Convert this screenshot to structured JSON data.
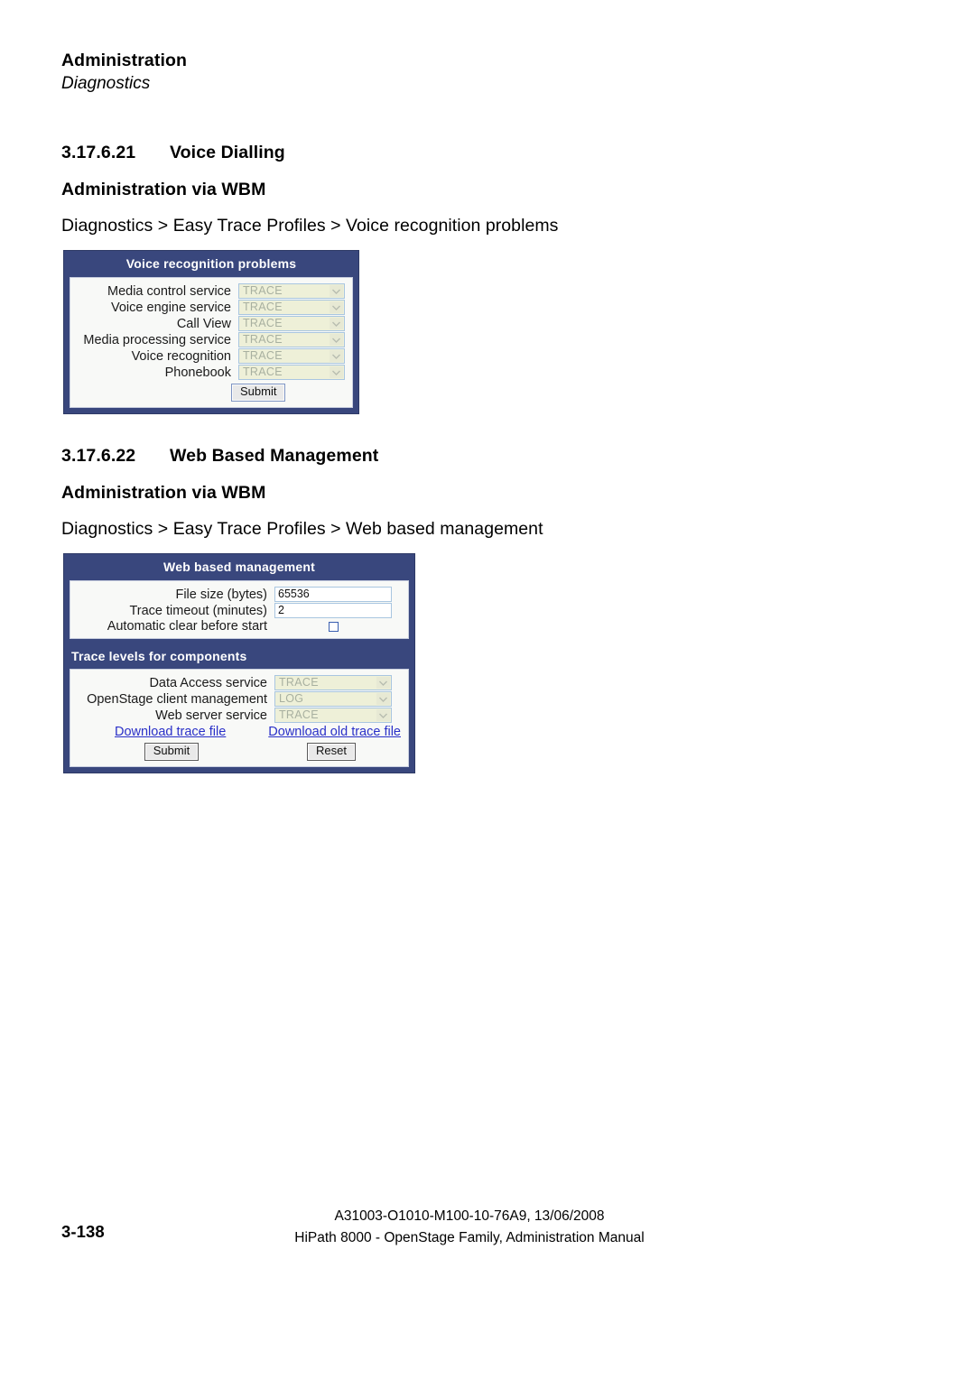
{
  "running_head": {
    "title": "Administration",
    "subtitle": "Diagnostics"
  },
  "sections": [
    {
      "number": "3.17.6.21",
      "title": "Voice Dialling",
      "subhead": "Administration via WBM",
      "breadcrumb": "Diagnostics > Easy Trace Profiles > Voice recognition problems"
    },
    {
      "number": "3.17.6.22",
      "title": "Web Based Management",
      "subhead": "Administration via WBM",
      "breadcrumb": "Diagnostics > Easy Trace Profiles > Web based management"
    }
  ],
  "dialog1": {
    "title": "Voice recognition problems",
    "rows": [
      {
        "label": "Media control service",
        "value": "TRACE"
      },
      {
        "label": "Voice engine service",
        "value": "TRACE"
      },
      {
        "label": "Call View",
        "value": "TRACE"
      },
      {
        "label": "Media processing service",
        "value": "TRACE"
      },
      {
        "label": "Voice recognition",
        "value": "TRACE"
      },
      {
        "label": "Phonebook",
        "value": "TRACE"
      }
    ],
    "submit_label": "Submit"
  },
  "dialog2": {
    "title": "Web based management",
    "fields": [
      {
        "label": "File size (bytes)",
        "value": "65536"
      },
      {
        "label": "Trace timeout (minutes)",
        "value": "2"
      }
    ],
    "checkbox_label": "Automatic clear before start",
    "band_label": "Trace levels for components",
    "rows": [
      {
        "label": "Data Access service",
        "value": "TRACE"
      },
      {
        "label": "OpenStage client management",
        "value": "LOG"
      },
      {
        "label": "Web server service",
        "value": "TRACE"
      }
    ],
    "link_download": "Download trace file",
    "link_download_old": "Download old trace file",
    "submit_label": "Submit",
    "reset_label": "Reset"
  },
  "footer": {
    "page_number": "3-138",
    "doc_id": "A31003-O1010-M100-10-76A9, 13/06/2008",
    "doc_title": "HiPath 8000 - OpenStage Family, Administration Manual"
  },
  "colors": {
    "wbm_header": "#39477d",
    "panel_bg": "#f8f9f7",
    "select_bg": "#eef0d8",
    "select_border": "#a9c6e0",
    "link": "#2a30c8"
  }
}
